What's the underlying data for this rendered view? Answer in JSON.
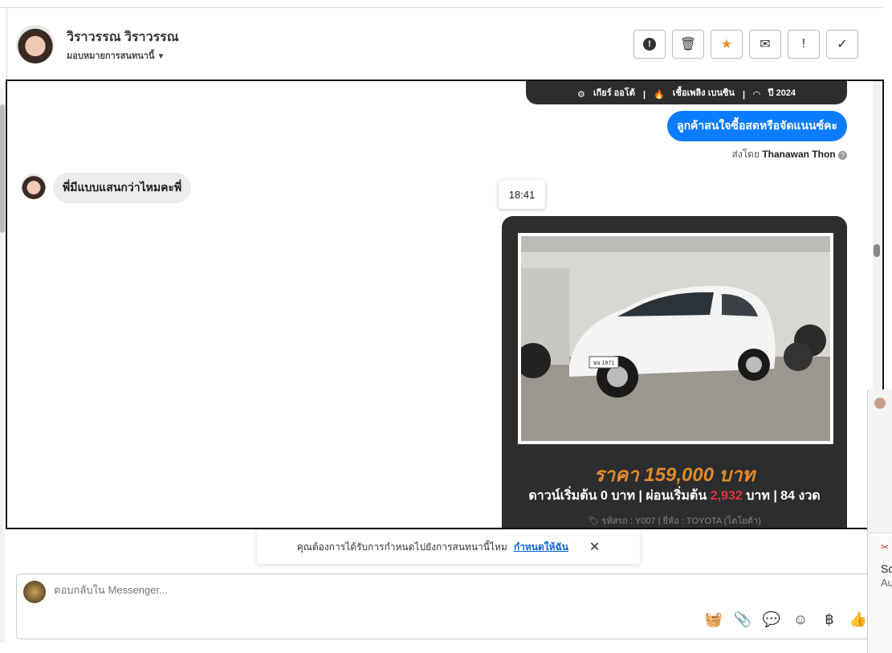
{
  "header": {
    "contact_name": "วิราวรรณ วิราวรรณ",
    "assign_label": "มอบหมายการสนทนานี้",
    "actions": [
      "spam",
      "delete",
      "star",
      "mark-unread",
      "important",
      "done"
    ]
  },
  "messages": {
    "card_top": {
      "gear": "เกียร์ ออโต้",
      "fuel": "เชื้อเพลิง เบนซิน",
      "year": "ปี 2024"
    },
    "outgoing": "ลูกค้าสนใจซื้อสดหรือจัดแนนซ์คะ",
    "sent_by_prefix": "ส่งโดย",
    "sent_by_name": "Thanawan Thon",
    "incoming": "พี่มีแบบแสนกว่าไหมคะพี่",
    "time": "18:41",
    "car_card": {
      "plate": "ษจ 1971",
      "price": "ราคา 159,000 บาท",
      "down_prefix": "ดาวน์เริ่มต้น 0 บาท | ผ่อนเริ่มต้น",
      "installment": "2,932",
      "down_suffix": "บาท | 84 งวด",
      "meta": "รหัสรถ : Y007 | ยี่ห้อ : TOYOTA (โตโยต้า)"
    }
  },
  "notice": {
    "text": "คุณต้องการได้รับการกำหนดไปยังการสนทนานี้ไหม",
    "link": "กำหนดให้ฉัน"
  },
  "composer": {
    "placeholder": "ตอบกลับใน Messenger..."
  },
  "side_panel": {
    "line1": "Sc",
    "line2": "Au"
  },
  "colors": {
    "accent": "#0a7cff",
    "price": "#e08a2c",
    "installment": "#e0353f",
    "card": "#2b2d2f"
  }
}
